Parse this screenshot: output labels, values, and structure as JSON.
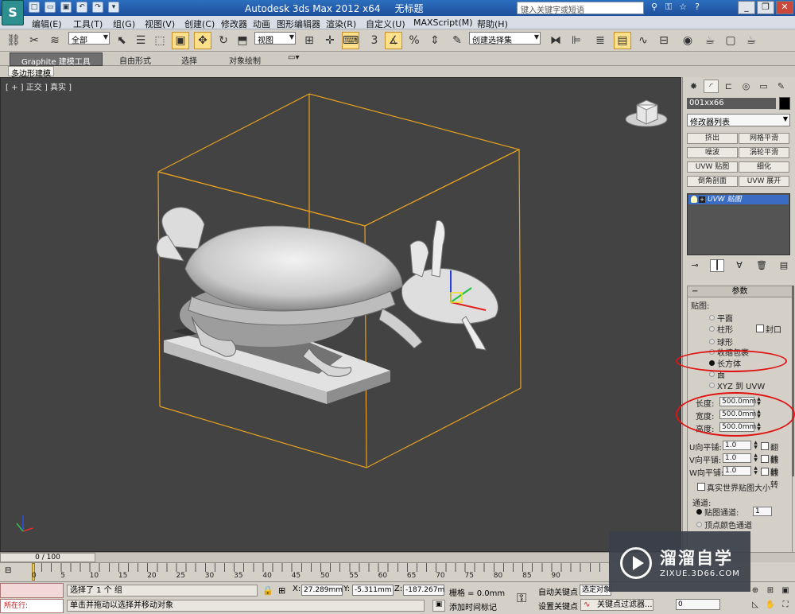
{
  "app": {
    "title": "Autodesk 3ds Max  2012 x64",
    "document": "无标题",
    "search_placeholder": "键入关键字或短语"
  },
  "menu": [
    "编辑(E)",
    "工具(T)",
    "组(G)",
    "视图(V)",
    "创建(C)",
    "修改器",
    "动画",
    "图形编辑器",
    "渲染(R)",
    "自定义(U)",
    "MAXScript(M)",
    "帮助(H)"
  ],
  "toolbar": {
    "selection_filter": "全部",
    "ref_coord": "视图",
    "snap_label": "3",
    "named_selection": "创建选择集"
  },
  "ribbon": {
    "tabs": [
      "Graphite 建模工具",
      "自由形式",
      "选择",
      "对象绘制"
    ],
    "active_tab": "Graphite 建模工具",
    "subtab": "多边形建模"
  },
  "viewport": {
    "label": "[ + ] 正交 ] 真实 ]"
  },
  "command_panel": {
    "object_name": "001xx66",
    "modifier_list": "修改器列表",
    "modifier_buttons": [
      "挤出",
      "网格平滑",
      "噪波",
      "涡轮平滑",
      "UVW 贴图",
      "细化",
      "倒角剖面",
      "UVW 展开"
    ],
    "stack_item": "UVW 贴图",
    "rollout_title": "参数",
    "mapping_group": "贴图:",
    "mapping_options": [
      "平面",
      "柱形",
      "球形",
      "收缩包裹",
      "长方体",
      "面",
      "XYZ 到 UVW"
    ],
    "selected_mapping": "长方体",
    "cap_label": "封口",
    "length_label": "长度:",
    "length_value": "500.0mm",
    "width_label": "宽度:",
    "width_value": "500.0mm",
    "height_label": "高度:",
    "height_value": "500.0mm",
    "u_tile_label": "U向平铺:",
    "u_tile": "1.0",
    "v_tile_label": "V向平铺:",
    "v_tile": "1.0",
    "w_tile_label": "W向平铺:",
    "w_tile": "1.0",
    "flip_label": "翻转",
    "real_world_label": "真实世界贴图大小",
    "channel_group": "通道:",
    "map_channel_label": "贴图通道:",
    "map_channel": "1",
    "vertex_color_label": "顶点颜色通道"
  },
  "timeline": {
    "slider": "0 / 100",
    "ticks": [
      "0",
      "5",
      "10",
      "15",
      "20",
      "25",
      "30",
      "35",
      "40",
      "45",
      "50",
      "55",
      "60",
      "65",
      "70",
      "75",
      "80",
      "85",
      "90"
    ]
  },
  "status": {
    "running_label": "所在行:",
    "selection": "选择了 1 个 组",
    "prompt": "单击并拖动以选择并移动对象",
    "x_label": "X:",
    "x": "27.289mm",
    "y_label": "Y:",
    "y": "-5.311mm",
    "z_label": "Z:",
    "z": "-187.267m",
    "grid": "栅格 = 0.0mm",
    "add_time_tag": "添加时间标记",
    "auto_key": "自动关键点",
    "selection_set": "选定对象",
    "set_key": "设置关键点",
    "key_filters": "关键点过滤器...",
    "frame": "0"
  },
  "watermark": {
    "title": "溜溜自学",
    "url": "ZIXUE.3D66.COM"
  },
  "colors": {
    "viewport_bg": "#434343",
    "bbox": "#e8a020",
    "highlight_ellipse": "#e01212",
    "stack_selected": "#3b6cc4"
  }
}
